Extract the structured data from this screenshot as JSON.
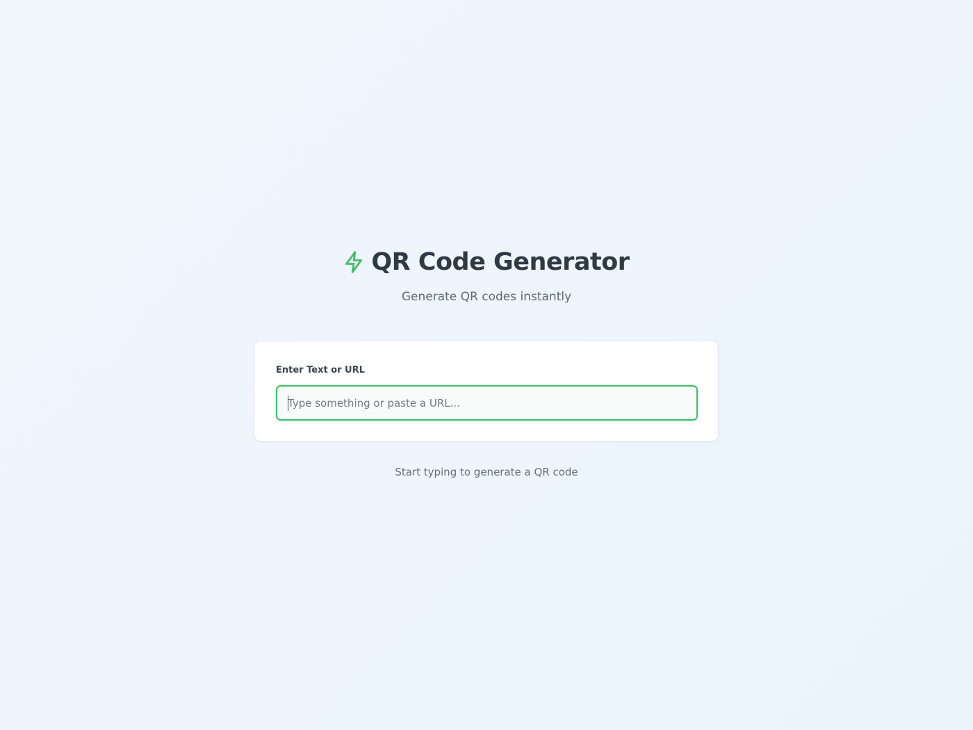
{
  "header": {
    "icon": "bolt-icon",
    "title": "QR Code Generator",
    "subtitle": "Generate QR codes instantly"
  },
  "form": {
    "label": "Enter Text or URL",
    "input_value": "",
    "input_placeholder": "Type something or paste a URL..."
  },
  "status": {
    "hint": "Start typing to generate a QR code"
  },
  "colors": {
    "accent": "#3fbf6a",
    "title_text": "#2f3a44",
    "muted_text": "#5f6a75",
    "card_background": "#ffffff",
    "page_background": "#eff5fd"
  }
}
